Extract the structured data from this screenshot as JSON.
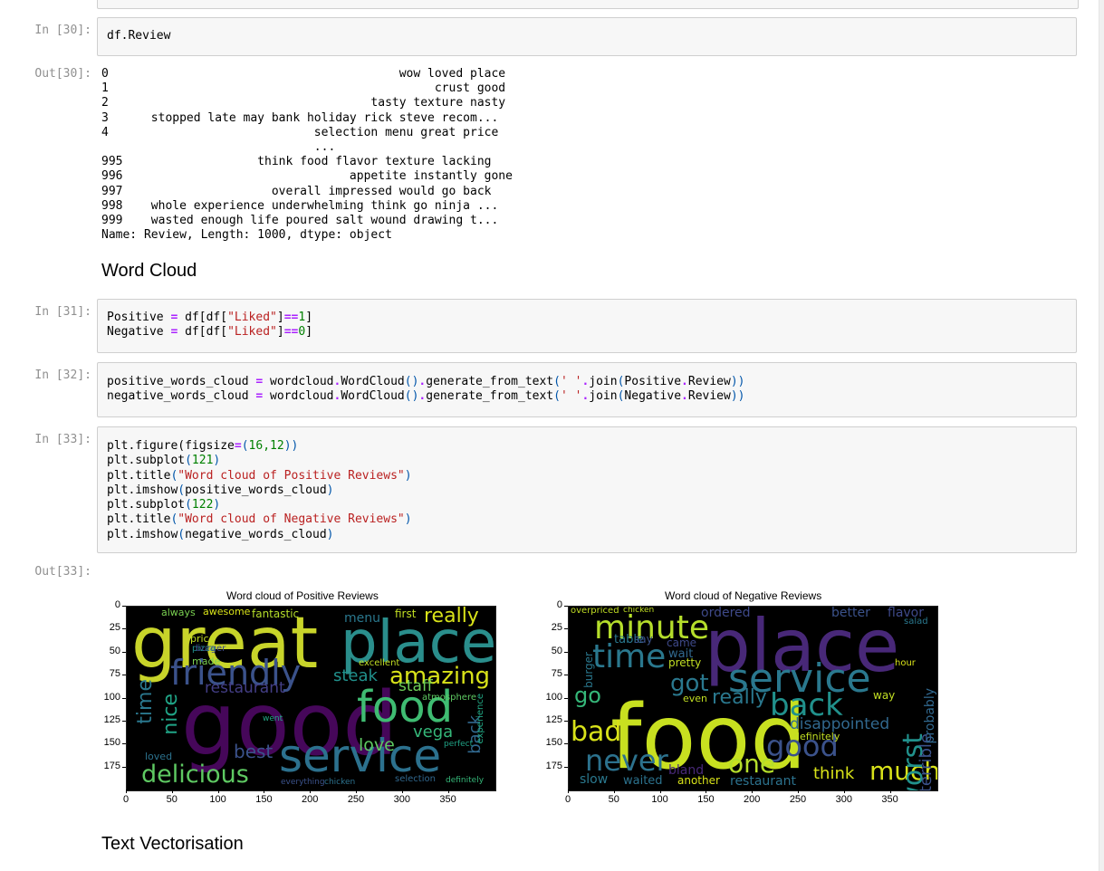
{
  "cells": {
    "c30": {
      "in_prompt": "In [30]:",
      "code": "df.Review",
      "out_prompt": "Out[30]:",
      "output_lines": [
        "0                                         wow loved place",
        "1                                              crust good",
        "2                                     tasty texture nasty",
        "3      stopped late may bank holiday rick steve recom...",
        "4                             selection menu great price",
        "                              ...                       ",
        "995                   think food flavor texture lacking",
        "996                                appetite instantly gone",
        "997                     overall impressed would go back",
        "998    whole experience underwhelming think go ninja ...",
        "999    wasted enough life poured salt wound drawing t...",
        "Name: Review, Length: 1000, dtype: object"
      ]
    },
    "heading_wordcloud": "Word Cloud",
    "c31": {
      "in_prompt": "In [31]:",
      "line1": {
        "a": "Positive ",
        "op": "=",
        "b": " df[df[",
        "s": "\"Liked\"",
        "c": "]",
        "op2": "==",
        "n": "1",
        "d": "]"
      },
      "line2": {
        "a": "Negative ",
        "op": "=",
        "b": " df[df[",
        "s": "\"Liked\"",
        "c": "]",
        "op2": "==",
        "n": "0",
        "d": "]"
      }
    },
    "c32": {
      "in_prompt": "In [32]:",
      "line1": {
        "a": "positive_words_cloud ",
        "op": "=",
        "b": " wordcloud",
        "dot": ".",
        "c": "WordCloud",
        "p1": "()",
        "dot2": ".",
        "d": "generate_from_text",
        "p2": "(",
        "s": "' '",
        "dot3": ".",
        "e": "join",
        "p3": "(",
        "f": "Positive",
        "dot4": ".",
        "g": "Review",
        "p4": "))"
      },
      "line2": {
        "a": "negative_words_cloud ",
        "op": "=",
        "b": " wordcloud",
        "dot": ".",
        "c": "WordCloud",
        "p1": "()",
        "dot2": ".",
        "d": "generate_from_text",
        "p2": "(",
        "s": "' '",
        "dot3": ".",
        "e": "join",
        "p3": "(",
        "f": "Negative",
        "dot4": ".",
        "g": "Review",
        "p4": "))"
      }
    },
    "c33": {
      "in_prompt": "In [33]:",
      "lines": [
        {
          "pre": "plt.figure(figsize",
          "op": "=",
          "p1": "(",
          "n": "16,12",
          "p2": "))",
          "s": ""
        },
        {
          "pre": "plt.subplot",
          "op": "",
          "p1": "(",
          "n": "121",
          "p2": ")",
          "s": ""
        },
        {
          "pre": "plt.title",
          "op": "",
          "p1": "(",
          "n": "",
          "p2": ")",
          "s": "\"Word cloud of Positive Reviews\""
        },
        {
          "pre": "plt.imshow",
          "op": "",
          "p1": "(",
          "n": "",
          "p2": ")",
          "s": "",
          "arg": "positive_words_cloud"
        },
        {
          "pre": "plt.subplot",
          "op": "",
          "p1": "(",
          "n": "122",
          "p2": ")",
          "s": ""
        },
        {
          "pre": "plt.title",
          "op": "",
          "p1": "(",
          "n": "",
          "p2": ")",
          "s": "\"Word cloud of Negative Reviews\""
        },
        {
          "pre": "plt.imshow",
          "op": "",
          "p1": "(",
          "n": "",
          "p2": ")",
          "s": "",
          "arg": "negative_words_cloud"
        }
      ],
      "out_prompt": "Out[33]:"
    },
    "heading_vectorisation": "Text Vectorisation"
  },
  "figures": {
    "positive": {
      "title": "Word cloud of Positive Reviews",
      "y_ticks": [
        "0",
        "25",
        "50",
        "75",
        "100",
        "125",
        "150",
        "175"
      ],
      "x_ticks": [
        "0",
        "50",
        "100",
        "150",
        "200",
        "250",
        "300",
        "350"
      ],
      "words": [
        {
          "w": "great",
          "c": "#c8d42a"
        },
        {
          "w": "place",
          "c": "#2a8e8c"
        },
        {
          "w": "good",
          "c": "#46075a"
        },
        {
          "w": "food",
          "c": "#3fbc72"
        },
        {
          "w": "service",
          "c": "#2c718e"
        },
        {
          "w": "friendly",
          "c": "#3b528b"
        },
        {
          "w": "amazing",
          "c": "#d8e219"
        },
        {
          "w": "delicious",
          "c": "#5ec962"
        },
        {
          "w": "really",
          "c": "#d8e219"
        },
        {
          "w": "time",
          "c": "#2a788e"
        },
        {
          "w": "nice",
          "c": "#20a486"
        },
        {
          "w": "restaurant",
          "c": "#433e85"
        },
        {
          "w": "steak",
          "c": "#21918c"
        },
        {
          "w": "staff",
          "c": "#6ece58"
        },
        {
          "w": "best",
          "c": "#3b528b"
        },
        {
          "w": "love",
          "c": "#5ec962"
        },
        {
          "w": "vega",
          "c": "#35b779"
        },
        {
          "w": "back",
          "c": "#31688e"
        },
        {
          "w": "menu",
          "c": "#2a788e"
        },
        {
          "w": "fantastic",
          "c": "#b5de2b"
        },
        {
          "w": "awesome",
          "c": "#d8e219"
        },
        {
          "w": "always",
          "c": "#7ad151"
        },
        {
          "w": "first",
          "c": "#c2df23"
        },
        {
          "w": "experience",
          "c": "#22a884"
        },
        {
          "w": "loved",
          "c": "#2c728e"
        },
        {
          "w": "made",
          "c": "#7ad151"
        },
        {
          "w": "price",
          "c": "#c2df23"
        },
        {
          "w": "atmosphere",
          "c": "#5ec962"
        },
        {
          "w": "selection",
          "c": "#31688e"
        },
        {
          "w": "definitely",
          "c": "#35b779"
        },
        {
          "w": "pizza",
          "c": "#21918c"
        },
        {
          "w": "chicken",
          "c": "#2c728e"
        },
        {
          "w": "everything",
          "c": "#3b528b"
        },
        {
          "w": "excellent",
          "c": "#c2df23"
        },
        {
          "w": "burger",
          "c": "#3e4989"
        },
        {
          "w": "went",
          "c": "#22a884"
        },
        {
          "w": "perfect",
          "c": "#20a486"
        }
      ]
    },
    "negative": {
      "title": "Word cloud of Negative Reviews",
      "y_ticks": [
        "0",
        "25",
        "50",
        "75",
        "100",
        "125",
        "150",
        "175"
      ],
      "x_ticks": [
        "0",
        "50",
        "100",
        "150",
        "200",
        "250",
        "300",
        "350"
      ],
      "words": [
        {
          "w": "food",
          "c": "#c8e020"
        },
        {
          "w": "place",
          "c": "#482878"
        },
        {
          "w": "service",
          "c": "#2a788e"
        },
        {
          "w": "minute",
          "c": "#b5de2b"
        },
        {
          "w": "time",
          "c": "#2a788e"
        },
        {
          "w": "back",
          "c": "#21918c"
        },
        {
          "w": "good",
          "c": "#3b528b"
        },
        {
          "w": "never",
          "c": "#2c728e"
        },
        {
          "w": "one",
          "c": "#b5de2b"
        },
        {
          "w": "much",
          "c": "#d8e219"
        },
        {
          "w": "bad",
          "c": "#d8e219"
        },
        {
          "w": "go",
          "c": "#35b779"
        },
        {
          "w": "got",
          "c": "#2a788e"
        },
        {
          "w": "really",
          "c": "#2a788e"
        },
        {
          "w": "disappointed",
          "c": "#31688e"
        },
        {
          "w": "worst",
          "c": "#21918c"
        },
        {
          "w": "think",
          "c": "#d8e219"
        },
        {
          "w": "ordered",
          "c": "#3e4989"
        },
        {
          "w": "better",
          "c": "#3b528b"
        },
        {
          "w": "flavor",
          "c": "#3e4989"
        },
        {
          "w": "terrible",
          "c": "#3b528b"
        },
        {
          "w": "probably",
          "c": "#31688e"
        },
        {
          "w": "restaurant",
          "c": "#2c728e"
        },
        {
          "w": "bland",
          "c": "#482878"
        },
        {
          "w": "another",
          "c": "#d8e219"
        },
        {
          "w": "waited",
          "c": "#2c728e"
        },
        {
          "w": "slow",
          "c": "#2a788e"
        },
        {
          "w": "definitely",
          "c": "#c2df23"
        },
        {
          "w": "overpriced",
          "c": "#c2df23"
        },
        {
          "w": "chicken",
          "c": "#c2df23"
        },
        {
          "w": "table",
          "c": "#2a788e"
        },
        {
          "w": "say",
          "c": "#3b528b"
        },
        {
          "w": "wait",
          "c": "#31688e"
        },
        {
          "w": "pretty",
          "c": "#c2df23"
        },
        {
          "w": "even",
          "c": "#c2df23"
        },
        {
          "w": "way",
          "c": "#c2df23"
        },
        {
          "w": "burger",
          "c": "#2a788e"
        },
        {
          "w": "came",
          "c": "#3e4989"
        },
        {
          "w": "salad",
          "c": "#2a788e"
        },
        {
          "w": "hour",
          "c": "#d8e219"
        }
      ]
    }
  }
}
